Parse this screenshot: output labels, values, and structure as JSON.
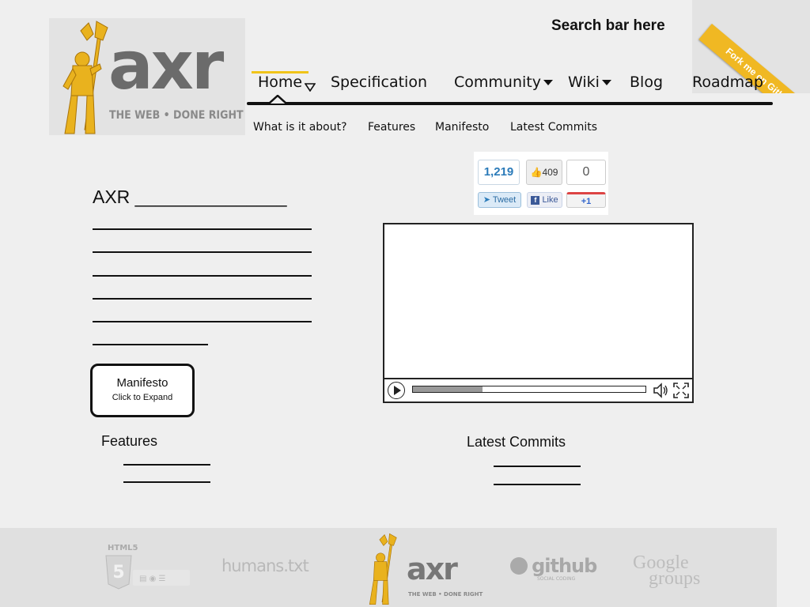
{
  "header": {
    "logo_text": "axr",
    "logo_tagline": "THE WEB  •  DONE RIGHT",
    "search_placeholder_text": "Search bar here",
    "ribbon": "Fork me on GitHub"
  },
  "nav": {
    "items": [
      {
        "label": "Home",
        "dropdown": true,
        "active": true
      },
      {
        "label": "Specification",
        "dropdown": false
      },
      {
        "label": "Community",
        "dropdown": true
      },
      {
        "label": "Wiki",
        "dropdown": true
      },
      {
        "label": "Blog",
        "dropdown": false
      },
      {
        "label": "Roadmap",
        "dropdown": false
      }
    ],
    "active_color": "#f0c419"
  },
  "subnav": {
    "items": [
      "What is it about?",
      "Features",
      "Manifesto",
      "Latest Commits"
    ]
  },
  "social": {
    "twitter_count": "1,219",
    "twitter_label": "Tweet",
    "facebook_count": "409",
    "facebook_label": "Like",
    "gplus_count": "0",
    "gplus_label": "+1"
  },
  "intro": {
    "heading": "AXR _______________"
  },
  "manifesto_button": {
    "title": "Manifesto",
    "subtitle": "Click to Expand"
  },
  "sections": {
    "features": "Features",
    "latest_commits": "Latest Commits"
  },
  "video": {
    "progress": 0.3
  },
  "footer": {
    "logos": [
      "HTML5",
      "humans.txt",
      "axr",
      "github",
      "Google groups"
    ],
    "axr_tagline": "THE WEB  •  DONE RIGHT",
    "github_tagline": "SOCIAL CODING"
  }
}
